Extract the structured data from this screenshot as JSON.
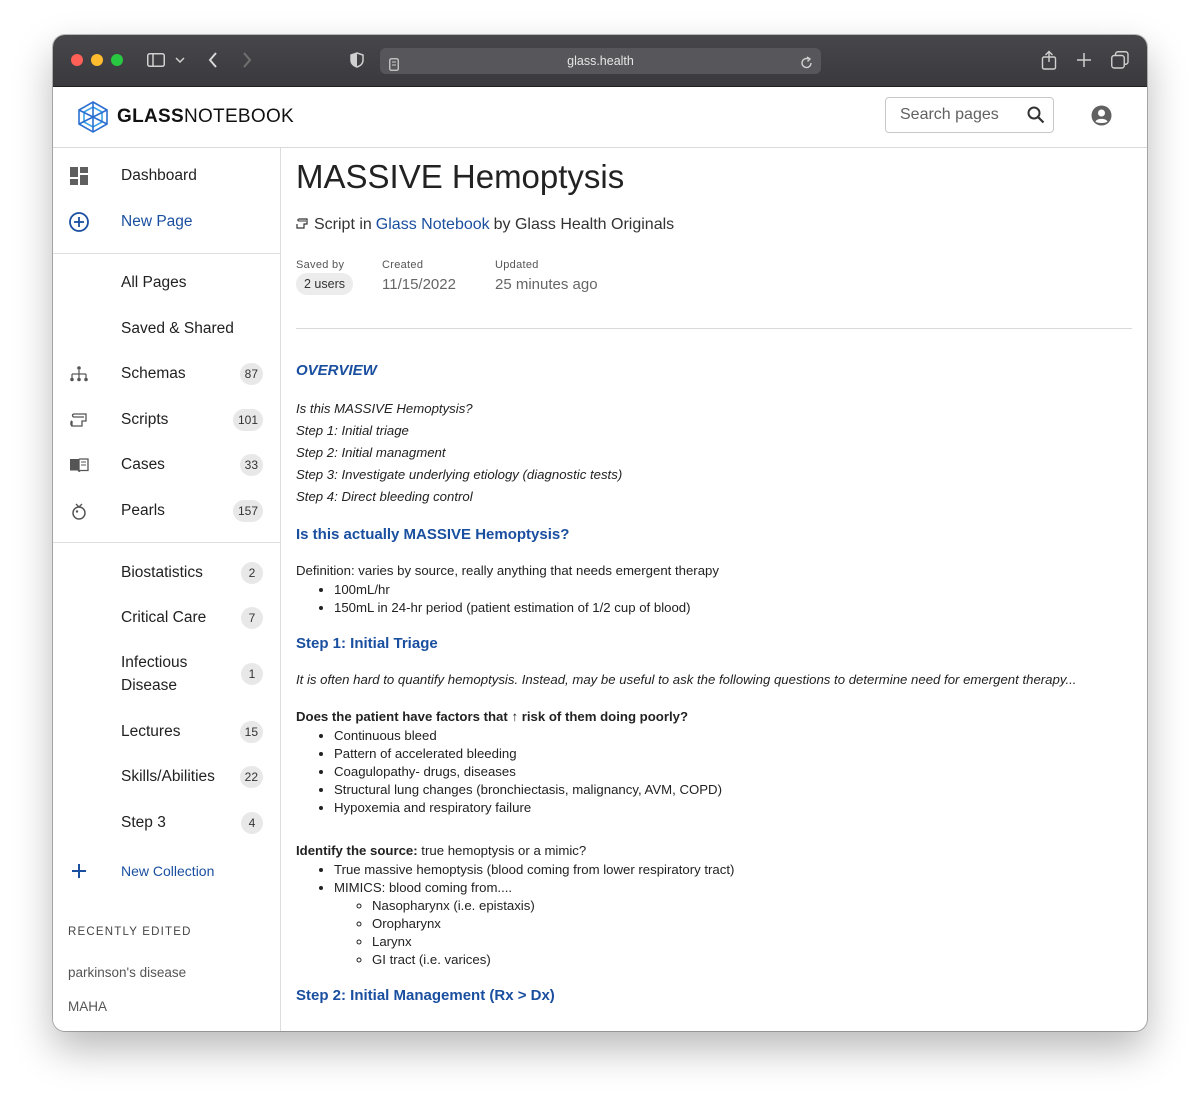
{
  "browser": {
    "url": "glass.health"
  },
  "header": {
    "logo_bold": "GLASS",
    "logo_light": "NOTEBOOK",
    "search_placeholder": "Search pages"
  },
  "sidebar": {
    "primary": [
      {
        "label": "Dashboard",
        "icon": "dashboard-icon"
      },
      {
        "label": "New Page",
        "icon": "add-circle-icon"
      }
    ],
    "pages": [
      {
        "label": "All Pages"
      },
      {
        "label": "Saved & Shared"
      },
      {
        "label": "Schemas",
        "count": "87",
        "icon": "schema-icon"
      },
      {
        "label": "Scripts",
        "count": "101",
        "icon": "script-icon"
      },
      {
        "label": "Cases",
        "count": "33",
        "icon": "book-icon"
      },
      {
        "label": "Pearls",
        "count": "157",
        "icon": "pearl-icon"
      }
    ],
    "collections": [
      {
        "label": "Biostatistics",
        "count": "2"
      },
      {
        "label": "Critical Care",
        "count": "7"
      },
      {
        "label": "Infectious Disease",
        "count": "1"
      },
      {
        "label": "Lectures",
        "count": "15"
      },
      {
        "label": "Skills/Abilities",
        "count": "22"
      },
      {
        "label": "Step 3",
        "count": "4"
      }
    ],
    "new_collection": "New Collection",
    "recently_edited_heading": "RECENTLY EDITED",
    "recently_edited": [
      "parkinson's disease",
      "MAHA"
    ]
  },
  "page": {
    "title": "MASSIVE Hemoptysis",
    "type_prefix": "Script in",
    "notebook_link": "Glass Notebook",
    "author": "by Glass Health Originals",
    "saved_by_label": "Saved by",
    "saved_by_value": "2 users",
    "created_label": "Created",
    "created_value": "11/15/2022",
    "updated_label": "Updated",
    "updated_value": "25 minutes ago"
  },
  "content": {
    "overview_heading": "OVERVIEW",
    "overview_items": [
      "Is this MASSIVE Hemoptysis?",
      "Step 1: Initial triage",
      "Step 2: Initial managment",
      "Step 3: Investigate underlying etiology (diagnostic tests)",
      "Step 4: Direct bleeding control"
    ],
    "section1_heading": "Is this actually MASSIVE Hemoptysis?",
    "definition": "Definition: varies by source, really anything that needs emergent therapy",
    "definition_items": [
      "100mL/hr",
      "150mL in 24-hr period (patient estimation of 1/2 cup of blood)"
    ],
    "section2_heading": "Step 1: Initial Triage",
    "triage_intro": "It is often hard to quantify hemoptysis. Instead, may be useful to ask the following questions to determine need for emergent therapy...",
    "risk_question": "Does the patient have factors that ↑ risk of them doing poorly?",
    "risk_items": [
      "Continuous bleed",
      "Pattern of accelerated bleeding",
      "Coagulopathy- drugs, diseases",
      "Structural lung changes (bronchiectasis, malignancy, AVM, COPD)",
      "Hypoxemia and respiratory failure"
    ],
    "source_bold": "Identify the source:",
    "source_rest": " true hemoptysis or a mimic?",
    "source_items": [
      "True massive hemoptysis (blood coming from lower respiratory tract)",
      "MIMICS: blood coming from...."
    ],
    "mimic_items": [
      "Nasopharynx (i.e. epistaxis)",
      "Oropharynx",
      "Larynx",
      "GI tract (i.e. varices)"
    ],
    "section3_heading": "Step 2: Initial Management (Rx > Dx)"
  }
}
